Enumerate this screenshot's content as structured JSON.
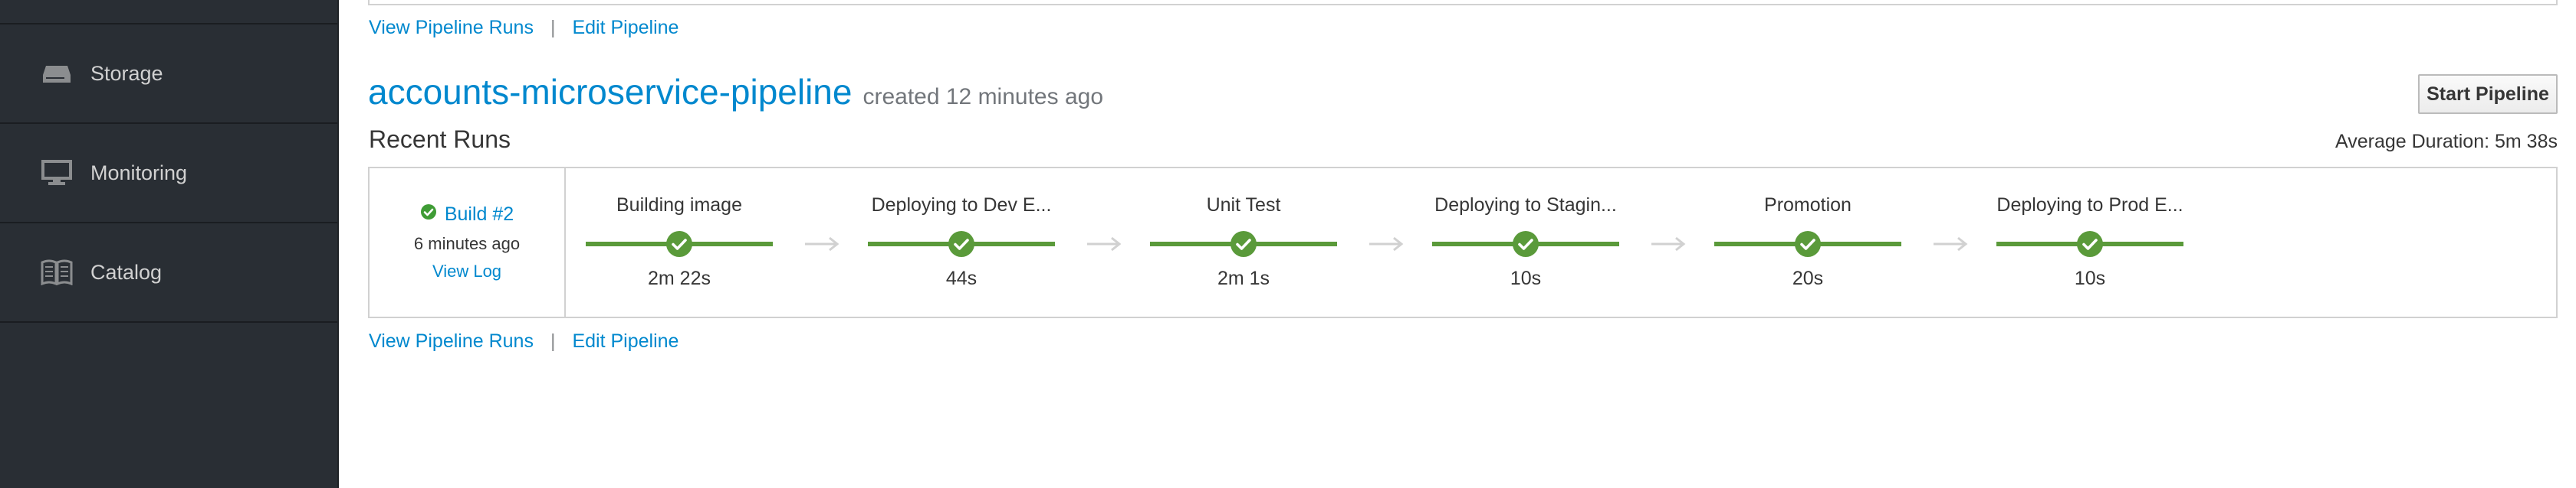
{
  "sidebar": {
    "items": [
      {
        "label": "Storage",
        "icon": "storage-icon"
      },
      {
        "label": "Monitoring",
        "icon": "monitor-icon"
      },
      {
        "label": "Catalog",
        "icon": "book-icon"
      }
    ]
  },
  "prev_pipeline": {
    "view_runs_label": "View Pipeline Runs",
    "separator": "|",
    "edit_label": "Edit Pipeline"
  },
  "pipeline": {
    "name": "accounts-microservice-pipeline",
    "created": "created 12 minutes ago",
    "start_button": "Start Pipeline",
    "recent_runs_label": "Recent Runs",
    "average_duration": "Average Duration: 5m 38s",
    "build": {
      "label": "Build #2",
      "time": "6 minutes ago",
      "view_log": "View Log",
      "status": "success"
    },
    "stages": [
      {
        "name": "Building image",
        "duration": "2m 22s",
        "status": "success"
      },
      {
        "name": "Deploying to Dev E...",
        "duration": "44s",
        "status": "success"
      },
      {
        "name": "Unit Test",
        "duration": "2m 1s",
        "status": "success"
      },
      {
        "name": "Deploying to Stagin...",
        "duration": "10s",
        "status": "success"
      },
      {
        "name": "Promotion",
        "duration": "20s",
        "status": "success"
      },
      {
        "name": "Deploying to Prod E...",
        "duration": "10s",
        "status": "success"
      }
    ],
    "view_runs_label": "View Pipeline Runs",
    "separator": "|",
    "edit_label": "Edit Pipeline"
  },
  "colors": {
    "link": "#0088ce",
    "success": "#3f9c35",
    "sidebar_bg": "#292e34"
  }
}
